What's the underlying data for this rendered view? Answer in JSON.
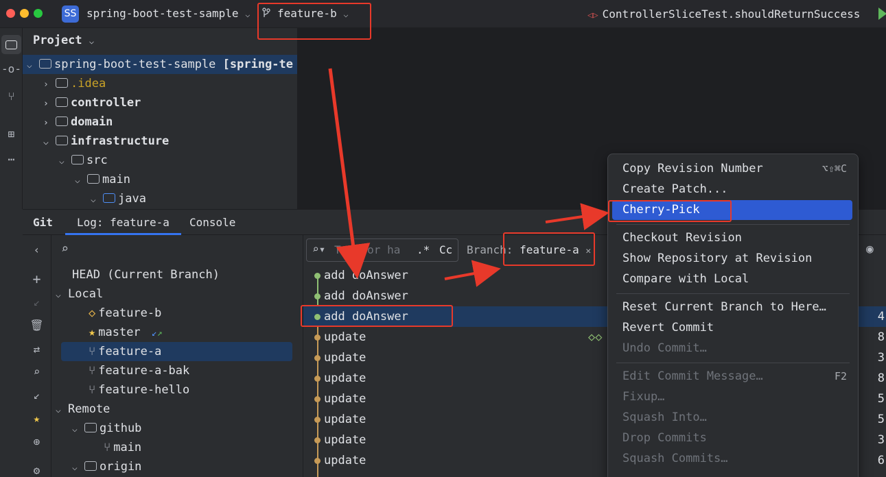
{
  "titlebar": {
    "project_badge": "SS",
    "project_name": "spring-boot-test-sample",
    "current_branch": "feature-b",
    "run_config": "ControllerSliceTest.shouldReturnSuccess"
  },
  "project_panel": {
    "title": "Project",
    "tree": [
      {
        "label": "spring-boot-test-sample",
        "suffix": "[spring-te",
        "level": 0,
        "open": true
      },
      {
        "label": ".idea",
        "level": 1,
        "open": false
      },
      {
        "label": "controller",
        "level": 1,
        "open": false
      },
      {
        "label": "domain",
        "level": 1,
        "open": false
      },
      {
        "label": "infrastructure",
        "level": 1,
        "open": true
      },
      {
        "label": "src",
        "level": 2,
        "open": true
      },
      {
        "label": "main",
        "level": 3,
        "open": true
      },
      {
        "label": "java",
        "level": 4,
        "open": true
      }
    ]
  },
  "git_tabs": {
    "tool": "Git",
    "log": "Log: feature-a",
    "console": "Console"
  },
  "branches": {
    "head": "HEAD (Current Branch)",
    "local": "Local",
    "local_items": [
      "feature-b",
      "master",
      "feature-a",
      "feature-a-bak",
      "feature-hello"
    ],
    "remote": "Remote",
    "github": "github",
    "github_main": "main",
    "origin": "origin"
  },
  "log_toolbar": {
    "search_placeholder": "Text or ha",
    "regex": ".*",
    "case": "Cc",
    "branch_label": "Branch:",
    "branch_value": "feature-a"
  },
  "commits": [
    {
      "message": "add doAnswer",
      "hash_tail": ""
    },
    {
      "message": "add doAnswer",
      "hash_tail": ""
    },
    {
      "message": "add doAnswer",
      "hash_tail": "4"
    },
    {
      "message": "update",
      "hash_tail": "8"
    },
    {
      "message": "update",
      "hash_tail": "3"
    },
    {
      "message": "update",
      "hash_tail": "8"
    },
    {
      "message": "update",
      "hash_tail": "5"
    },
    {
      "message": "update",
      "hash_tail": "5"
    },
    {
      "message": "update",
      "hash_tail": "3"
    },
    {
      "message": "update",
      "hash_tail": "6"
    }
  ],
  "context_menu": {
    "items": [
      {
        "label": "Copy Revision Number",
        "shortcut": "⌥⇧⌘C",
        "disabled": false
      },
      {
        "label": "Create Patch...",
        "shortcut": "",
        "disabled": false
      },
      {
        "label": "Cherry-Pick",
        "shortcut": "",
        "disabled": false
      },
      {
        "label": "Checkout Revision",
        "shortcut": "",
        "disabled": false
      },
      {
        "label": "Show Repository at Revision",
        "shortcut": "",
        "disabled": false
      },
      {
        "label": "Compare with Local",
        "shortcut": "",
        "disabled": false
      },
      {
        "label": "Reset Current Branch to Here…",
        "shortcut": "",
        "disabled": false
      },
      {
        "label": "Revert Commit",
        "shortcut": "",
        "disabled": false
      },
      {
        "label": "Undo Commit…",
        "shortcut": "",
        "disabled": true
      },
      {
        "label": "Edit Commit Message…",
        "shortcut": "F2",
        "disabled": true
      },
      {
        "label": "Fixup…",
        "shortcut": "",
        "disabled": true
      },
      {
        "label": "Squash Into…",
        "shortcut": "",
        "disabled": true
      },
      {
        "label": "Drop Commits",
        "shortcut": "",
        "disabled": true
      },
      {
        "label": "Squash Commits…",
        "shortcut": "",
        "disabled": true
      }
    ]
  },
  "colors": {
    "accent": "#2e5bd3",
    "annotation": "#e8392a",
    "selection": "#1f3a5f",
    "graph_green": "#8fbf73",
    "graph_gold": "#c69a57"
  }
}
